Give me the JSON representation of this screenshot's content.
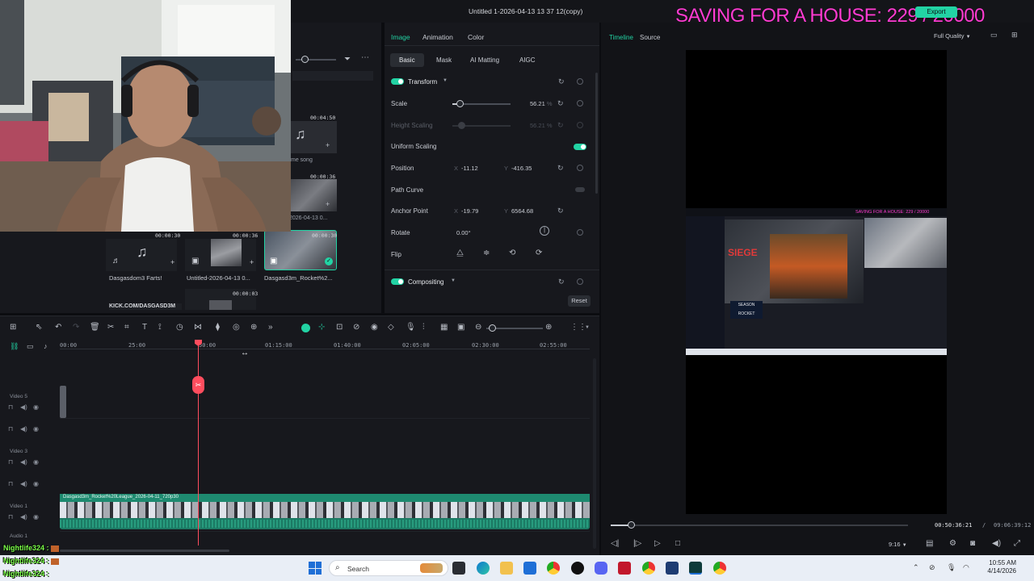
{
  "window": {
    "title": "Untitled 1-2026-04-13 13 37 12(copy)",
    "export_label": "Export",
    "overlay_banner": "SAVING FOR A HOUSE: 229 / 20000"
  },
  "media": {
    "items_top": [
      {
        "duration": "00:04:50",
        "caption": "me song"
      },
      {
        "duration": "00:00:36",
        "caption": "2026-04-13 0..."
      }
    ],
    "items_bottom": [
      {
        "duration": "00:00:30",
        "caption": "Dasgasdom3 Farts!"
      },
      {
        "duration": "00:00:36",
        "caption": "Untitled-2026-04-13 0..."
      },
      {
        "duration": "00:00:30",
        "caption": "Dasgasd3m_Rocket%2..."
      }
    ],
    "last_duration": "00:00:03",
    "bottom_text": "KICK.COM/DASGASD3M"
  },
  "properties": {
    "tabs": [
      "Image",
      "Animation",
      "Color"
    ],
    "subtabs": [
      "Basic",
      "Mask",
      "AI Matting",
      "AIGC"
    ],
    "sections": {
      "transform": "Transform",
      "compositing": "Compositing"
    },
    "scale": {
      "label": "Scale",
      "value": "56.21",
      "unit": "%",
      "fraction": 0.12
    },
    "height_scaling": {
      "label": "Height Scaling",
      "value": "56.21",
      "unit": "%"
    },
    "uniform_scaling": {
      "label": "Uniform Scaling"
    },
    "position": {
      "label": "Position",
      "x_label": "X",
      "x": "-11.12",
      "y_label": "Y",
      "y": "-416.35"
    },
    "path_curve": {
      "label": "Path Curve"
    },
    "anchor": {
      "label": "Anchor Point",
      "x_label": "X",
      "x": "-19.79",
      "y_label": "Y",
      "y": "6564.68"
    },
    "rotate": {
      "label": "Rotate",
      "value": "0.00°"
    },
    "flip": {
      "label": "Flip"
    },
    "reset_label": "Reset"
  },
  "preview": {
    "tabs": [
      "Timeline",
      "Source"
    ],
    "quality": "Full Quality",
    "current_time": "00:50:36:21",
    "separator": "/",
    "total_time": "09:06:39:12",
    "aspect": "9:16",
    "progress_fraction": 0.067,
    "embedded": {
      "banner": "SAVING FOR A HOUSE: 229 / 20000",
      "game_title": "SIEGE",
      "season_text": "SEASON ROCKET"
    }
  },
  "timeline": {
    "ruler": [
      "00:00",
      "25:00",
      "00:50:00",
      "01:15:00",
      "01:40:00",
      "02:05:00",
      "02:30:00",
      "02:55:00"
    ],
    "ruler_display": [
      "00:00",
      "25:00",
      "50:00",
      "01:15:00",
      "01:40:00",
      "02:05:00",
      "02:30:00",
      "02:55:00"
    ],
    "tracks": [
      {
        "label": "Video 5"
      },
      {
        "label": "Video 3"
      },
      {
        "label": "Video 1"
      },
      {
        "label": "Audio 1"
      }
    ],
    "clip_name": "Dasgasd3m_Rocket%20League_2026-04-11_720p30"
  },
  "chat": [
    {
      "user": "Nightlife324",
      "text": ":"
    },
    {
      "user": "Nightlife324",
      "text": ":"
    },
    {
      "user": "Nightlife324",
      "text": ":"
    }
  ],
  "taskbar": {
    "search_placeholder": "Search",
    "time": "10:55 AM",
    "date": "4/14/2026"
  },
  "colors": {
    "accent": "#22d3a4",
    "playhead": "#ff4d5e",
    "banner": "#ff3cd2",
    "chat": "#7cff4a"
  }
}
